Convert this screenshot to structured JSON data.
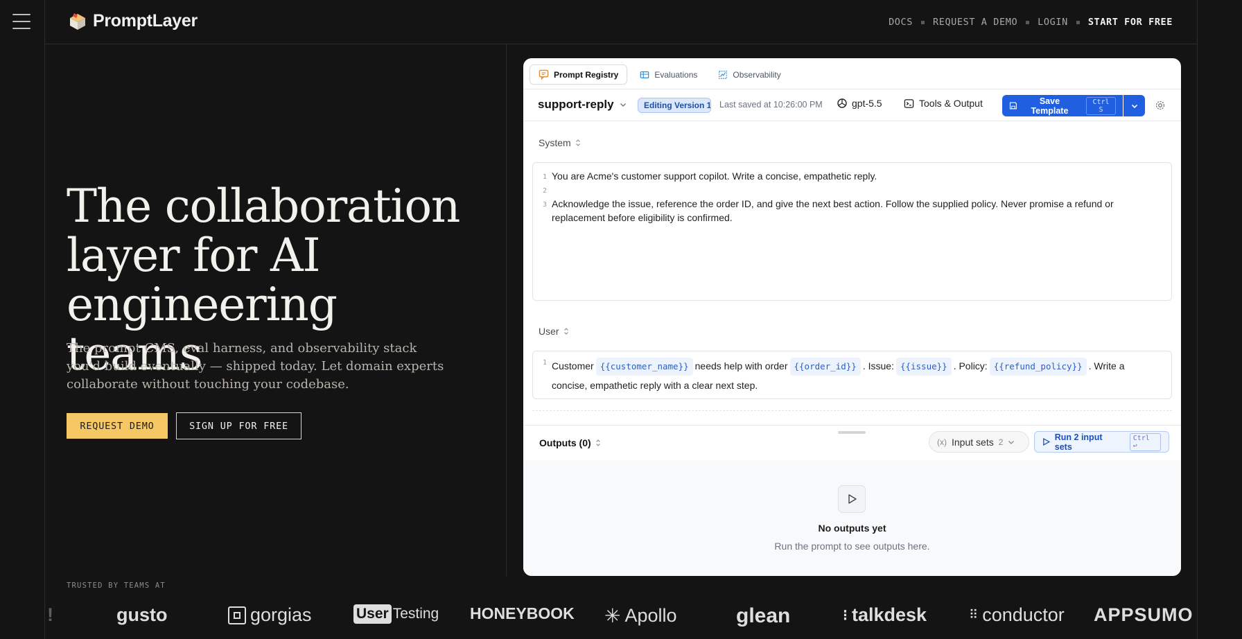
{
  "header": {
    "brand": "PromptLayer",
    "nav": [
      {
        "label": "DOCS"
      },
      {
        "label": "REQUEST A DEMO"
      },
      {
        "label": "LOGIN"
      },
      {
        "label": "START FOR FREE"
      }
    ]
  },
  "hero": {
    "title_lines": [
      "The collaboration",
      "layer for AI",
      "engineering teams"
    ],
    "subtitle": "The prompt CMS, eval harness, and observability stack you'd build eventually — shipped today. Let domain experts collaborate without touching your codebase.",
    "primary_cta": "REQUEST DEMO",
    "secondary_cta": "SIGN UP FOR FREE"
  },
  "trusted": {
    "label": "TRUSTED BY TEAMS AT",
    "logos": [
      "!",
      "gusto",
      "gorgias",
      "User",
      "Testing",
      "HONEYBOOK",
      "Apollo",
      "glean",
      "talkdesk",
      "conductor",
      "APPSUMO"
    ]
  },
  "app": {
    "tabs": [
      {
        "label": "Prompt Registry",
        "icon": "chat-bubble-icon",
        "active": true
      },
      {
        "label": "Evaluations",
        "icon": "table-icon",
        "active": false
      },
      {
        "label": "Observability",
        "icon": "chart-frame-icon",
        "active": false
      }
    ],
    "template_name": "support-reply",
    "version_badge": "Editing Version 1",
    "last_saved": "Last saved at 10:26:00 PM",
    "model": "gpt-5.5",
    "tools_label": "Tools & Output",
    "save_label": "Save Template",
    "save_shortcut": "Ctrl S",
    "system": {
      "label": "System",
      "lines": [
        {
          "n": "1",
          "text": "You are Acme's customer support copilot. Write a concise, empathetic reply."
        },
        {
          "n": "2",
          "text": ""
        },
        {
          "n": "3",
          "text": "Acknowledge the issue, reference the order ID, and give the next best action. Follow the supplied policy. Never promise a refund or replacement before eligibility is confirmed."
        }
      ]
    },
    "user": {
      "label": "User",
      "line_no": "1",
      "parts": {
        "p1": "Customer",
        "v1": "{{customer_name}}",
        "p2": "needs help with order",
        "v2": "{{order_id}}",
        "p3": ". Issue:",
        "v3": "{{issue}}",
        "p4": ". Policy:",
        "v4": "{{refund_policy}}",
        "p5": ". Write a concise, empathetic reply with a clear next step."
      }
    },
    "outputs": {
      "label": "Outputs (0)",
      "input_sets_label": "Input sets",
      "input_sets_count": "2",
      "run_label": "Run 2 input sets",
      "run_shortcut": "Ctrl ↩",
      "empty_title": "No outputs yet",
      "empty_sub": "Run the prompt to see outputs here."
    }
  },
  "colors": {
    "page_bg": "#141414",
    "accent_yellow": "#f5c865",
    "brand_blue": "#1f5fe0",
    "var_blue": "#2b5fc6"
  }
}
